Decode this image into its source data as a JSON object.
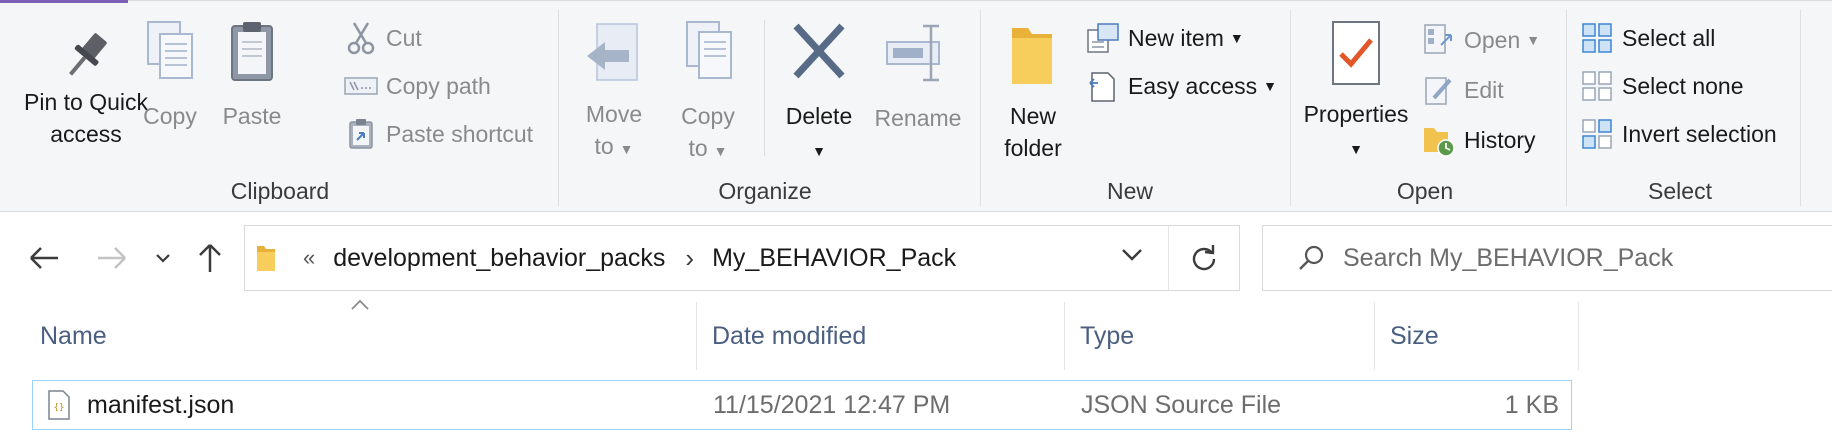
{
  "ribbon": {
    "clipboard": {
      "label": "Clipboard",
      "pin": [
        "Pin to Quick",
        "access"
      ],
      "copy": "Copy",
      "paste": "Paste",
      "cut": "Cut",
      "copy_path": "Copy path",
      "paste_shortcut": "Paste shortcut"
    },
    "organize": {
      "label": "Organize",
      "move_to": [
        "Move",
        "to"
      ],
      "copy_to": [
        "Copy",
        "to"
      ],
      "delete": "Delete",
      "rename": "Rename"
    },
    "new": {
      "label": "New",
      "new_folder": [
        "New",
        "folder"
      ],
      "new_item": "New item",
      "easy_access": "Easy access"
    },
    "open": {
      "label": "Open",
      "properties": "Properties",
      "open": "Open",
      "edit": "Edit",
      "history": "History"
    },
    "select": {
      "label": "Select",
      "select_all": "Select all",
      "select_none": "Select none",
      "invert_selection": "Invert selection"
    }
  },
  "address": {
    "overflow": "«",
    "crumbs": [
      "development_behavior_packs",
      "My_BEHAVIOR_Pack"
    ],
    "separator": "›"
  },
  "search": {
    "placeholder": "Search My_BEHAVIOR_Pack"
  },
  "columns": [
    "Name",
    "Date modified",
    "Type",
    "Size"
  ],
  "files": [
    {
      "name": "manifest.json",
      "date": "11/15/2021 12:47 PM",
      "type": "JSON Source File",
      "size": "1 KB"
    }
  ],
  "colors": {
    "accent": "#7e5fb8",
    "selection_border": "#99d1ff",
    "header_text": "#4a5f80",
    "folder": "#f4c65a",
    "check": "#e2562a"
  }
}
